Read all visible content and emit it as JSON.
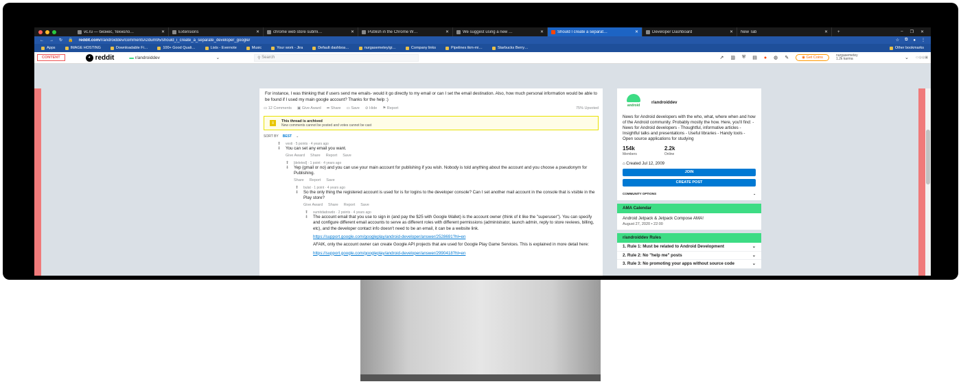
{
  "browser": {
    "tabs": [
      {
        "label": "vc.ru — бизнес, техноло…",
        "active": false
      },
      {
        "label": "Extensions",
        "active": false
      },
      {
        "label": "chrome web store submi…",
        "active": false
      },
      {
        "label": "Publish in the Chrome W…",
        "active": false
      },
      {
        "label": "We suggest using a new …",
        "active": false
      },
      {
        "label": "Should I create a separat…",
        "active": true
      },
      {
        "label": "Developer Dashboard",
        "active": false
      },
      {
        "label": "New Tab",
        "active": false
      }
    ],
    "new_tab": "+",
    "url_domain": "reddit.com",
    "url_path": "/r/androiddev/comments/i2dum95/should_i_create_a_separate_developer_google/",
    "bookmarks": [
      "Apps",
      "IMAGE HOSTING",
      "Downloadable Fi…",
      "100+ Good Quali…",
      "Lists - Evernote",
      "Music",
      "Your work - Jira",
      "Default dashboa…",
      "nurgasemetey/gi…",
      "Company links",
      "Pipelines tkm-mi…",
      "Starbucks Berry…"
    ],
    "other_bookmarks": "Other bookmarks"
  },
  "reddit": {
    "skip": "CONTENT",
    "logo": "reddit",
    "community": "r/androiddev",
    "search_placeholder": "Search",
    "get_coins": "Get Coins",
    "username": "nurgasemetey",
    "karma": "1.2k karma"
  },
  "post": {
    "text": "For instance, I was thinking that if users send me emails- would it go directly to my email or can I set the email destination. Also, how much personal information would be able to be found if I used my main google account? Thanks for the help :)",
    "actions": [
      "12 Comments",
      "Give Award",
      "Share",
      "Save",
      "Hide",
      "Report"
    ],
    "upvoted": "75% Upvoted",
    "archived_title": "This thread is archived",
    "archived_sub": "New comments cannot be posted and votes cannot be cast",
    "sort_label": "SORT BY",
    "sort_value": "BEST"
  },
  "comments": [
    {
      "author": "vexti",
      "meta": "5 points · 4 years ago",
      "body": "You can set any email you want.",
      "actions": [
        "Give Award",
        "Share",
        "Report",
        "Save"
      ]
    },
    {
      "author": "[deleted]",
      "meta": "1 point · 4 years ago",
      "body": "Yep (gmail or no) and you can use your main account for publishing if you wish. Nobody is told anything about the account and you choose a pseudonym for Publishing.",
      "actions": [
        "Share",
        "Report",
        "Save"
      ]
    },
    {
      "author": "bulat",
      "meta": "1 point · 4 years ago",
      "body": "So the only thing the registered account is used for is for logins to the developer console? Can I set another mail account in the console that is visible in the Play store?",
      "actions": [
        "Give Award",
        "Share",
        "Report",
        "Save"
      ]
    },
    {
      "author": "sumitdadowdo",
      "meta": "2 points · 4 years ago",
      "body": "The account email that you use to sign in (and pay the $25 with Google Wallet) is the account owner (think of it like the \"superuser\"). You can specify and configure different email accounts to serve as different roles with different permissions (administrator, launch admin, reply to store reviews, billing, etc), and the developer contact info doesn't need to be an email, it can be a website link.",
      "link1": "https://support.google.com/googleplay/android-developer/answer/2528691?hl=en",
      "body2": "AFAIK, only the account owner can create Google API projects that are used for Google Play Game Services. This is explained in more detail here:",
      "link2": "https://support.google.com/googleplay/android-developer/answer/2990418?hl=en"
    }
  ],
  "sidebar": {
    "name": "r/androiddev",
    "icon_text": "android",
    "desc": "News for Android developers with the who, what, where when and how of the Android community. Probably mostly the how. Here, you'll find: - News for Android developers - Thoughtful, informative articles - Insightful talks and presentations - Useful libraries - Handy tools - Open source applications for studying",
    "members": "154k",
    "members_label": "Members",
    "online": "2.2k",
    "online_label": "Online",
    "created": "Created Jul 12, 2009",
    "join": "JOIN",
    "create": "CREATE POST",
    "options": "COMMUNITY OPTIONS",
    "ama_title": "AMA Calendar",
    "ama_event": "Android Jetpack & Jetpack Compose AMA!",
    "ama_date": "August 27, 2020 • 22:00",
    "rules_title": "r/androiddev Rules",
    "rules": [
      "1. Rule 1: Must be related to Android Development",
      "2. Rule 2: No \"help me\" posts",
      "3. Rule 3: No promoting your apps without source code"
    ]
  }
}
